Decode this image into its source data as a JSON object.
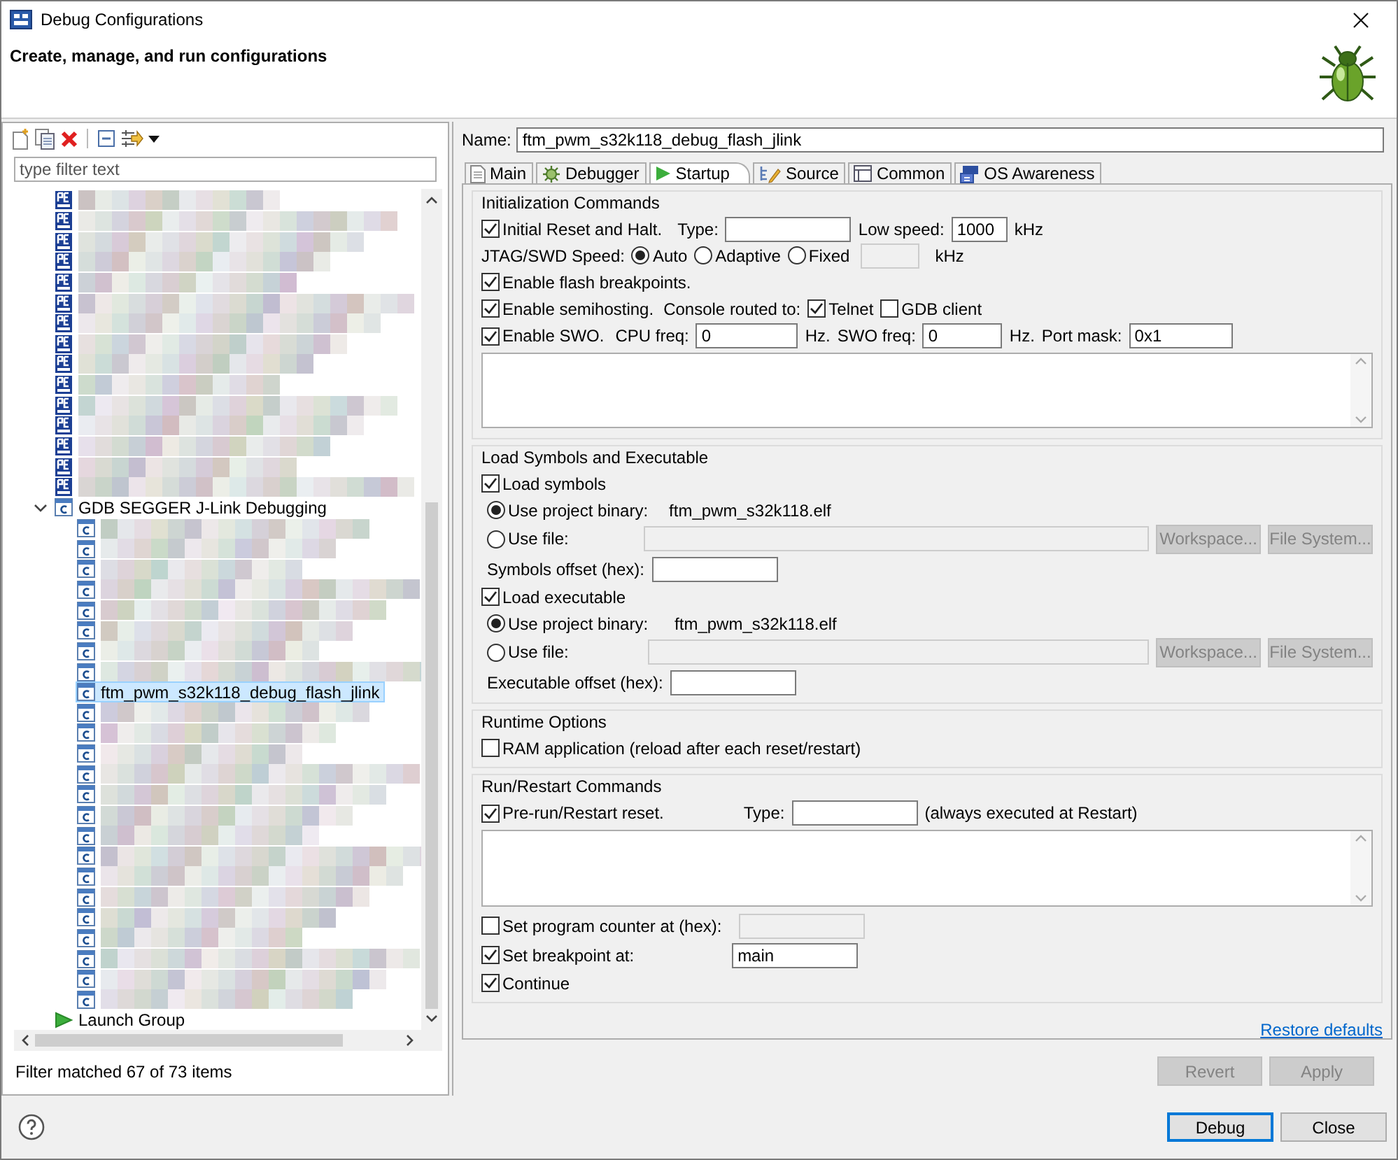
{
  "window": {
    "title": "Debug Configurations"
  },
  "header": {
    "title": "Create, manage, and run configurations"
  },
  "left": {
    "filter_placeholder": "type filter text",
    "tree": [
      {
        "kind": "redacted",
        "selected": false
      },
      {
        "kind": "redacted",
        "selected": false
      },
      {
        "kind": "redacted",
        "selected": false
      },
      {
        "kind": "redacted",
        "selected": false
      },
      {
        "kind": "redacted",
        "selected": false
      },
      {
        "kind": "redacted",
        "selected": false
      },
      {
        "kind": "redacted",
        "selected": false
      },
      {
        "kind": "redacted",
        "selected": false
      },
      {
        "kind": "redacted",
        "selected": false
      },
      {
        "kind": "redacted",
        "selected": false
      },
      {
        "kind": "redacted",
        "selected": false
      },
      {
        "kind": "redacted",
        "selected": false
      },
      {
        "kind": "redacted",
        "selected": false
      },
      {
        "kind": "redacted",
        "selected": false
      },
      {
        "kind": "redacted",
        "selected": false
      },
      {
        "kind": "group",
        "label": "GDB SEGGER J-Link Debugging",
        "expanded": true,
        "selected": false,
        "children": [
          {
            "kind": "redacted",
            "selected": false
          },
          {
            "kind": "redacted",
            "selected": false
          },
          {
            "kind": "redacted",
            "selected": false
          },
          {
            "kind": "redacted",
            "selected": false
          },
          {
            "kind": "redacted",
            "selected": false
          },
          {
            "kind": "redacted",
            "selected": false
          },
          {
            "kind": "redacted",
            "selected": false
          },
          {
            "kind": "redacted",
            "selected": false
          },
          {
            "kind": "item",
            "label": "ftm_pwm_s32k118_debug_flash_jlink",
            "selected": true
          },
          {
            "kind": "redacted",
            "selected": false
          },
          {
            "kind": "redacted",
            "selected": false
          },
          {
            "kind": "redacted",
            "selected": false
          },
          {
            "kind": "redacted",
            "selected": false
          },
          {
            "kind": "redacted",
            "selected": false
          },
          {
            "kind": "redacted",
            "selected": false
          },
          {
            "kind": "redacted",
            "selected": false
          },
          {
            "kind": "redacted",
            "selected": false
          },
          {
            "kind": "redacted",
            "selected": false
          },
          {
            "kind": "redacted",
            "selected": false
          },
          {
            "kind": "redacted",
            "selected": false
          },
          {
            "kind": "redacted",
            "selected": false
          },
          {
            "kind": "redacted",
            "selected": false
          },
          {
            "kind": "redacted",
            "selected": false
          },
          {
            "kind": "redacted",
            "selected": false
          }
        ]
      },
      {
        "kind": "item",
        "label": "Launch Group",
        "selected": false
      }
    ],
    "status": "Filter matched 67 of 73 items"
  },
  "name_label": "Name:",
  "name": "ftm_pwm_s32k118_debug_flash_jlink",
  "tabs": [
    {
      "label": "Main",
      "selected": false
    },
    {
      "label": "Debugger",
      "selected": false
    },
    {
      "label": "Startup",
      "selected": true
    },
    {
      "label": "Source",
      "selected": false
    },
    {
      "label": "Common",
      "selected": false
    },
    {
      "label": "OS Awareness",
      "selected": false
    }
  ],
  "init": {
    "title": "Initialization Commands",
    "reset": {
      "label": "Initial Reset and Halt.",
      "checked": true
    },
    "type_label": "Type:",
    "low_speed_label": "Low speed:",
    "low_speed": "1000",
    "low_speed_unit": "kHz",
    "speed_label": "JTAG/SWD Speed:",
    "speed_options": [
      {
        "label": "Auto",
        "selected": true
      },
      {
        "label": "Adaptive",
        "selected": false
      },
      {
        "label": "Fixed",
        "selected": false
      }
    ],
    "fixed_unit": "kHz",
    "flash_bp": {
      "label": "Enable flash breakpoints.",
      "checked": true
    },
    "semihosting": {
      "label": "Enable semihosting.",
      "checked": true
    },
    "console_label": "Console routed to:",
    "telnet": {
      "label": "Telnet",
      "checked": true
    },
    "gdb_client": {
      "label": "GDB client",
      "checked": false
    },
    "swo": {
      "label": "Enable SWO.",
      "checked": true
    },
    "cpu_freq_label": "CPU freq:",
    "cpu_freq": "0",
    "cpu_unit": "Hz.",
    "swo_freq_label": "SWO freq:",
    "swo_freq": "0",
    "swo_unit": "Hz.",
    "port_mask_label": "Port mask:",
    "port_mask": "0x1"
  },
  "load": {
    "title": "Load Symbols and Executable",
    "blocks": [
      {
        "check": {
          "label": "Load symbols",
          "checked": true
        },
        "project": {
          "label": "Use project binary:",
          "selected": true
        },
        "binary": "ftm_pwm_s32k118.elf",
        "file": {
          "label": "Use file:",
          "selected": false
        },
        "workspace": "Workspace...",
        "file_system": "File System...",
        "offset_label": "Symbols offset (hex):"
      },
      {
        "check": {
          "label": "Load executable",
          "checked": true
        },
        "project": {
          "label": "Use project binary:",
          "selected": true
        },
        "binary": "ftm_pwm_s32k118.elf",
        "file": {
          "label": "Use file:",
          "selected": false
        },
        "workspace": "Workspace...",
        "file_system": "File System...",
        "offset_label": "Executable offset (hex):"
      }
    ]
  },
  "runtime": {
    "title": "Runtime Options",
    "ram": {
      "label": "RAM application (reload after each reset/restart)",
      "checked": false
    }
  },
  "run": {
    "title": "Run/Restart Commands",
    "prerun": {
      "label": "Pre-run/Restart reset.",
      "checked": true
    },
    "type_label": "Type:",
    "note": "(always executed at Restart)",
    "set_pc": {
      "label": "Set program counter at (hex):",
      "checked": false
    },
    "set_bp": {
      "label": "Set breakpoint at:",
      "checked": true
    },
    "bp_value": "main",
    "cont": {
      "label": "Continue",
      "checked": true
    }
  },
  "restore_defaults": "Restore defaults",
  "panel_buttons": [
    {
      "label": "Revert",
      "disabled": true
    },
    {
      "label": "Apply",
      "disabled": true
    }
  ],
  "buttons": [
    {
      "label": "Debug",
      "default": true
    },
    {
      "label": "Close",
      "default": false
    }
  ]
}
